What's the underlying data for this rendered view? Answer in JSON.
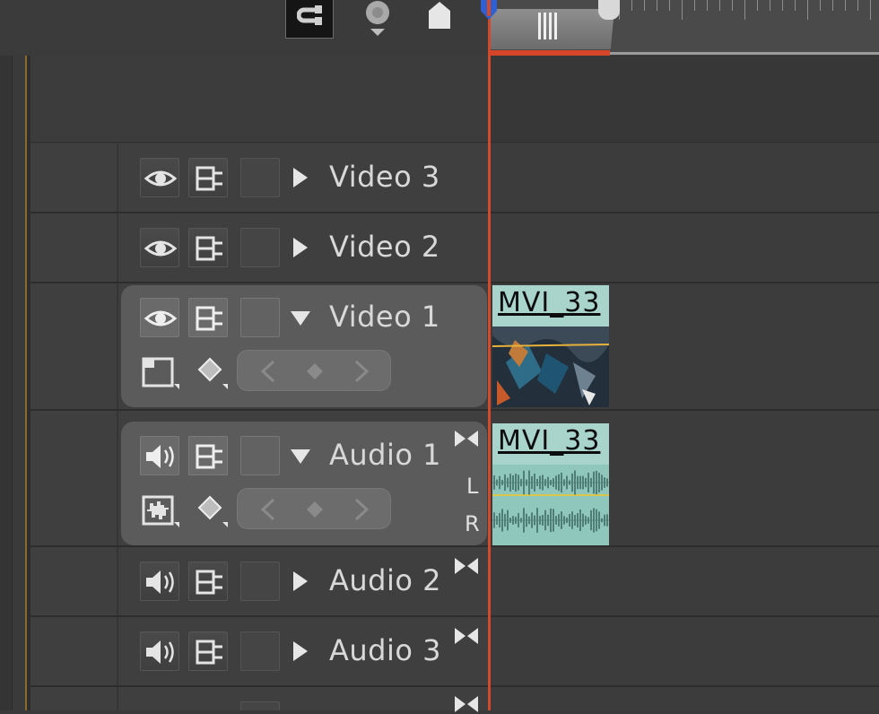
{
  "toolbar": {
    "snap_icon": "magnet-snap-icon",
    "marker_icon": "add-marker-icon",
    "keyframe_icon": "add-keyframe-icon"
  },
  "tracks": {
    "video3": {
      "label": "Video 3",
      "expanded": false
    },
    "video2": {
      "label": "Video 2",
      "expanded": false
    },
    "video1": {
      "label": "Video 1",
      "expanded": true
    },
    "audio1": {
      "label": "Audio 1",
      "expanded": true,
      "left_channel": "L",
      "right_channel": "R"
    },
    "audio2": {
      "label": "Audio 2",
      "expanded": false
    },
    "audio3": {
      "label": "Audio 3",
      "expanded": false
    }
  },
  "clips": {
    "video_clip": {
      "label": "MVI_33"
    },
    "audio_clip": {
      "label": "MVI_33"
    }
  },
  "colors": {
    "playhead": "#d24a2a",
    "clip_audio": "#8fc7bd",
    "clip_video": "#a8d4cc",
    "panel_bg": "#5b5b5b"
  }
}
